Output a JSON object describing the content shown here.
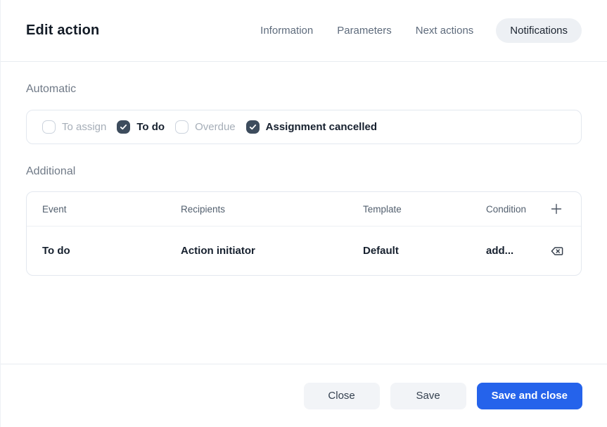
{
  "header": {
    "title": "Edit action",
    "tabs": [
      {
        "label": "Information",
        "active": false
      },
      {
        "label": "Parameters",
        "active": false
      },
      {
        "label": "Next actions",
        "active": false
      },
      {
        "label": "Notifications",
        "active": true
      }
    ]
  },
  "automatic": {
    "label": "Automatic",
    "options": [
      {
        "label": "To assign",
        "checked": false
      },
      {
        "label": "To do",
        "checked": true
      },
      {
        "label": "Overdue",
        "checked": false
      },
      {
        "label": "Assignment cancelled",
        "checked": true
      }
    ]
  },
  "additional": {
    "label": "Additional",
    "columns": {
      "event": "Event",
      "recipients": "Recipients",
      "template": "Template",
      "condition": "Condition"
    },
    "add_icon": "plus-icon",
    "rows": [
      {
        "event": "To do",
        "recipients": "Action initiator",
        "template": "Default",
        "condition": "add...",
        "delete_icon": "backspace-icon"
      }
    ]
  },
  "footer": {
    "close_label": "Close",
    "save_label": "Save",
    "save_and_close_label": "Save and close"
  },
  "colors": {
    "primary_button": "#2563eb",
    "checkbox_checked": "#3d4c5d",
    "active_tab_bg": "#edf0f4",
    "divider": "#e8ecf1"
  }
}
